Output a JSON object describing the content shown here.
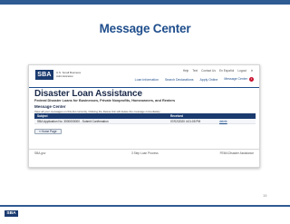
{
  "slide": {
    "title": "Message Center",
    "page_number": "15",
    "logo_text": "SBA"
  },
  "header": {
    "logo_mark": "SBA",
    "logo_words": "U.S. Small Business Administration",
    "util_links": [
      "Help",
      "Text",
      "Contact Us",
      "En Español",
      "Logout"
    ],
    "nav": {
      "loan_information": "Loan Information",
      "search_declarations": "Search Declarations",
      "apply_online": "Apply Online",
      "message_center": "Message Center",
      "message_count": "1"
    }
  },
  "banner": {
    "title": "Disaster Loan Assistance",
    "subtitle": "Federal Disaster Loans for Businesses, Private Nonprofits, Homeowners, and Renters"
  },
  "messages": {
    "section_title": "Message Center",
    "description": "View all your messages on this list currently. Clicking the Delete link will delete the message immediately.",
    "columns": [
      "Subject",
      "Received",
      ""
    ],
    "rows": [
      {
        "subject": "SBA Application No. 3000000000 - Submit Confirmation",
        "received": "07/02/2020 4:01:05 PM",
        "action": "delete"
      }
    ],
    "home_button": "« Home Page"
  },
  "footer": {
    "left": "SBA.gov",
    "middle": "3 Step Loan Process",
    "right": "FEMA Disaster Assistance"
  }
}
